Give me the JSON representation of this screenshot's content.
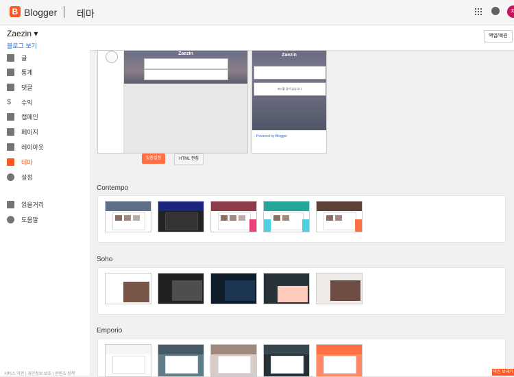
{
  "app": {
    "logo_letter": "B",
    "name": "Blogger",
    "page": "테마",
    "avatar": "자"
  },
  "blog": {
    "title": "Zaezin",
    "view_link": "블로그 보기",
    "backup_button": "백업/복원"
  },
  "sidebar": {
    "items": [
      {
        "label": "글",
        "icon": "posts-icon"
      },
      {
        "label": "통계",
        "icon": "stats-icon"
      },
      {
        "label": "댓글",
        "icon": "comments-icon"
      },
      {
        "label": "수익",
        "icon": "dollar-icon"
      },
      {
        "label": "캠페인",
        "icon": "campaign-icon"
      },
      {
        "label": "페이지",
        "icon": "pages-icon"
      },
      {
        "label": "레이아웃",
        "icon": "layout-icon"
      },
      {
        "label": "테마",
        "icon": "theme-icon"
      },
      {
        "label": "설정",
        "icon": "gear-icon"
      }
    ],
    "items2": [
      {
        "label": "읽을거리",
        "icon": "bookmark-icon"
      },
      {
        "label": "도움말",
        "icon": "help-icon"
      }
    ],
    "footer": "서비스 약관 | 개인정보 보호 | 콘텐츠 정책"
  },
  "preview": {
    "desktop_title": "Zaezin",
    "mobile_title": "Zaezin",
    "mobile_empty": "표시할 글이 없습니다.",
    "powered": "Powered by Blogger",
    "customize_button": "맞춤설정",
    "html_button": "HTML 편집"
  },
  "sections": [
    {
      "title": "Contempo",
      "colors": [
        "#5c6f87",
        "#1a237e",
        "#ec407a",
        "#4dd0e1",
        "#ff7043"
      ]
    },
    {
      "title": "Soho",
      "colors": [
        "#795548",
        "#212121",
        "#0d1b2a",
        "#263238",
        "#6d4c41"
      ]
    },
    {
      "title": "Emporio",
      "colors": [
        "#e0e0e0",
        "#607d8b",
        "#d7ccc8",
        "#263238",
        "#ff8a65"
      ]
    }
  ],
  "feedback": "의견 보내기",
  "colors": {
    "accent": "#ff5722",
    "link": "#1a73e8"
  }
}
